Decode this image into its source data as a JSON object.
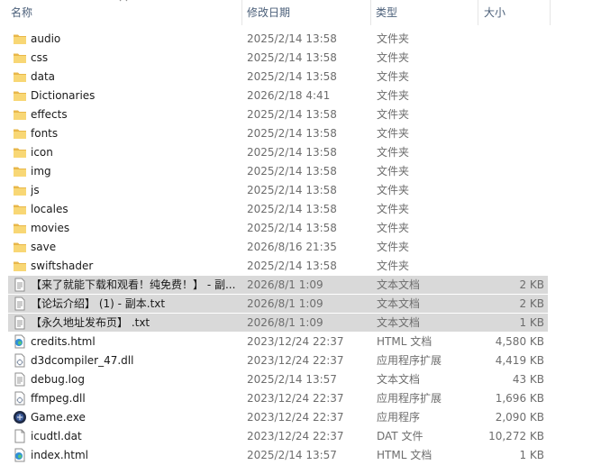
{
  "header": {
    "name_label": "名称",
    "date_label": "修改日期",
    "type_label": "类型",
    "size_label": "大小",
    "sort_icon": "chevron-up-icon"
  },
  "rows": [
    {
      "name": "audio",
      "date": "2025/2/14 13:58",
      "type": "文件夹",
      "size": "",
      "icon": "folder-icon",
      "selected": false
    },
    {
      "name": "css",
      "date": "2025/2/14 13:58",
      "type": "文件夹",
      "size": "",
      "icon": "folder-icon",
      "selected": false
    },
    {
      "name": "data",
      "date": "2025/2/14 13:58",
      "type": "文件夹",
      "size": "",
      "icon": "folder-icon",
      "selected": false
    },
    {
      "name": "Dictionaries",
      "date": "2026/2/18 4:41",
      "type": "文件夹",
      "size": "",
      "icon": "folder-icon",
      "selected": false
    },
    {
      "name": "effects",
      "date": "2025/2/14 13:58",
      "type": "文件夹",
      "size": "",
      "icon": "folder-icon",
      "selected": false
    },
    {
      "name": "fonts",
      "date": "2025/2/14 13:58",
      "type": "文件夹",
      "size": "",
      "icon": "folder-icon",
      "selected": false
    },
    {
      "name": "icon",
      "date": "2025/2/14 13:58",
      "type": "文件夹",
      "size": "",
      "icon": "folder-icon",
      "selected": false
    },
    {
      "name": "img",
      "date": "2025/2/14 13:58",
      "type": "文件夹",
      "size": "",
      "icon": "folder-icon",
      "selected": false
    },
    {
      "name": "js",
      "date": "2025/2/14 13:58",
      "type": "文件夹",
      "size": "",
      "icon": "folder-icon",
      "selected": false
    },
    {
      "name": "locales",
      "date": "2025/2/14 13:58",
      "type": "文件夹",
      "size": "",
      "icon": "folder-icon",
      "selected": false
    },
    {
      "name": "movies",
      "date": "2025/2/14 13:58",
      "type": "文件夹",
      "size": "",
      "icon": "folder-icon",
      "selected": false
    },
    {
      "name": "save",
      "date": "2026/8/16 21:35",
      "type": "文件夹",
      "size": "",
      "icon": "folder-icon",
      "selected": false
    },
    {
      "name": "swiftshader",
      "date": "2025/2/14 13:58",
      "type": "文件夹",
      "size": "",
      "icon": "folder-icon",
      "selected": false
    },
    {
      "name": "【来了就能下载和观看！纯免费！】 - 副...",
      "date": "2026/8/1 1:09",
      "type": "文本文档",
      "size": "2 KB",
      "icon": "text-file-icon",
      "selected": true
    },
    {
      "name": "【论坛介绍】 (1) - 副本.txt",
      "date": "2026/8/1 1:09",
      "type": "文本文档",
      "size": "2 KB",
      "icon": "text-file-icon",
      "selected": true
    },
    {
      "name": "【永久地址发布页】 .txt",
      "date": "2026/8/1 1:09",
      "type": "文本文档",
      "size": "1 KB",
      "icon": "text-file-icon",
      "selected": true
    },
    {
      "name": "credits.html",
      "date": "2023/12/24 22:37",
      "type": "HTML 文档",
      "size": "4,580 KB",
      "icon": "edge-html-icon",
      "selected": false
    },
    {
      "name": "d3dcompiler_47.dll",
      "date": "2023/12/24 22:37",
      "type": "应用程序扩展",
      "size": "4,419 KB",
      "icon": "dll-file-icon",
      "selected": false
    },
    {
      "name": "debug.log",
      "date": "2025/2/14 13:57",
      "type": "文本文档",
      "size": "43 KB",
      "icon": "text-file-icon",
      "selected": false
    },
    {
      "name": "ffmpeg.dll",
      "date": "2023/12/24 22:37",
      "type": "应用程序扩展",
      "size": "1,696 KB",
      "icon": "dll-file-icon",
      "selected": false
    },
    {
      "name": "Game.exe",
      "date": "2023/12/24 22:37",
      "type": "应用程序",
      "size": "2,090 KB",
      "icon": "game-app-icon",
      "selected": false
    },
    {
      "name": "icudtl.dat",
      "date": "2023/12/24 22:37",
      "type": "DAT 文件",
      "size": "10,272 KB",
      "icon": "blank-file-icon",
      "selected": false
    },
    {
      "name": "index.html",
      "date": "2025/2/14 13:57",
      "type": "HTML 文档",
      "size": "1 KB",
      "icon": "edge-html-icon",
      "selected": false
    }
  ]
}
